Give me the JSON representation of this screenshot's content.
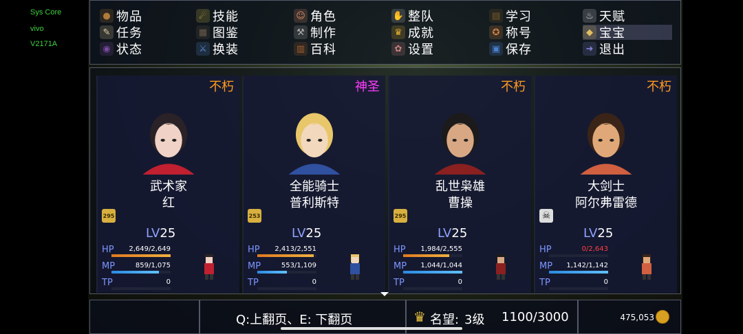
{
  "system": {
    "line1": "Sys Core",
    "line2": "vivo",
    "line3": "V2171A"
  },
  "menu": [
    {
      "label": "物品",
      "icon": "bag-icon",
      "color": "#b07a3a",
      "glyph": "●"
    },
    {
      "label": "技能",
      "icon": "swirl-icon",
      "color": "#d9c24a",
      "glyph": "☄"
    },
    {
      "label": "角色",
      "icon": "masks-icon",
      "color": "#d58a6a",
      "glyph": "☺"
    },
    {
      "label": "整队",
      "icon": "hand-flag-icon",
      "color": "#c0c0c0",
      "glyph": "✋"
    },
    {
      "label": "学习",
      "icon": "book-icon",
      "color": "#7a5a2a",
      "glyph": "▤"
    },
    {
      "label": "天赋",
      "icon": "potion-icon",
      "color": "#d8d8e0",
      "glyph": "♨"
    },
    {
      "label": "任务",
      "icon": "scroll-icon",
      "color": "#e2cfa0",
      "glyph": "✎"
    },
    {
      "label": "图鉴",
      "icon": "tome-icon",
      "color": "#6a5a4a",
      "glyph": "▦"
    },
    {
      "label": "制作",
      "icon": "anvil-icon",
      "color": "#b0b0b0",
      "glyph": "⚒"
    },
    {
      "label": "成就",
      "icon": "trophy-icon",
      "color": "#e0b030",
      "glyph": "♛"
    },
    {
      "label": "称号",
      "icon": "medal-icon",
      "color": "#d08040",
      "glyph": "✪"
    },
    {
      "label": "宝宝",
      "icon": "duck-icon",
      "color": "#e0c060",
      "glyph": "◆"
    },
    {
      "label": "状态",
      "icon": "orb-icon",
      "color": "#7a4aa0",
      "glyph": "◉"
    },
    {
      "label": "换装",
      "icon": "armor-icon",
      "color": "#5a8ad0",
      "glyph": "⚔"
    },
    {
      "label": "百科",
      "icon": "encyclopedia-icon",
      "color": "#a06030",
      "glyph": "▥"
    },
    {
      "label": "设置",
      "icon": "gear-icon",
      "color": "#c88080",
      "glyph": "✿"
    },
    {
      "label": "保存",
      "icon": "floppy-icon",
      "color": "#4a80d0",
      "glyph": "▣"
    },
    {
      "label": "退出",
      "icon": "exit-icon",
      "color": "#8080d0",
      "glyph": "➜"
    }
  ],
  "selected_menu": "宝宝",
  "characters": [
    {
      "rank": "不朽",
      "rank_color": "#ff9a20",
      "class": "武术家",
      "name": "红",
      "badge": "295",
      "lv_label": "LV",
      "lv": "25",
      "hp": "2,649/2,649",
      "hp_frac": 1.0,
      "mp": "859/1,075",
      "mp_frac": 0.8,
      "tp": "0",
      "skull": false,
      "hair": "#2a2226",
      "skin": "#f0d2c6",
      "cloth": "#c02030"
    },
    {
      "rank": "神圣",
      "rank_color": "#ff3cff",
      "class": "全能骑士",
      "name": "普利斯特",
      "badge": "253",
      "lv_label": "LV",
      "lv": "25",
      "hp": "2,413/2,551",
      "hp_frac": 0.95,
      "mp": "553/1,109",
      "mp_frac": 0.5,
      "tp": "0",
      "skull": false,
      "hair": "#e8c66a",
      "skin": "#f2d8bc",
      "cloth": "#3050a0"
    },
    {
      "rank": "不朽",
      "rank_color": "#ff9a20",
      "class": "乱世枭雄",
      "name": "曹操",
      "badge": "295",
      "lv_label": "LV",
      "lv": "25",
      "hp": "1,984/2,555",
      "hp_frac": 0.78,
      "mp": "1,044/1,044",
      "mp_frac": 1.0,
      "tp": "0",
      "skull": false,
      "hair": "#1c1a1a",
      "skin": "#d8a884",
      "cloth": "#8a2020"
    },
    {
      "rank": "不朽",
      "rank_color": "#ff9a20",
      "class": "大剑士",
      "name": "阿尔弗雷德",
      "badge": "",
      "lv_label": "LV",
      "lv": "25",
      "hp": "0/2,643",
      "hp_frac": 0.0,
      "mp": "1,142/1,142",
      "mp_frac": 1.0,
      "tp": "0",
      "skull": true,
      "hair": "#3a2418",
      "skin": "#e0a878",
      "cloth": "#d06040"
    }
  ],
  "hp_zero_color": "#ff4040",
  "labels": {
    "hp": "HP",
    "mp": "MP",
    "tp": "TP"
  },
  "bottom": {
    "paging": "Q:上翻页、E: 下翻页",
    "fame_label": "名望:",
    "fame_level": "3级",
    "fame_progress": "1100/3000",
    "gold": "475,053"
  }
}
